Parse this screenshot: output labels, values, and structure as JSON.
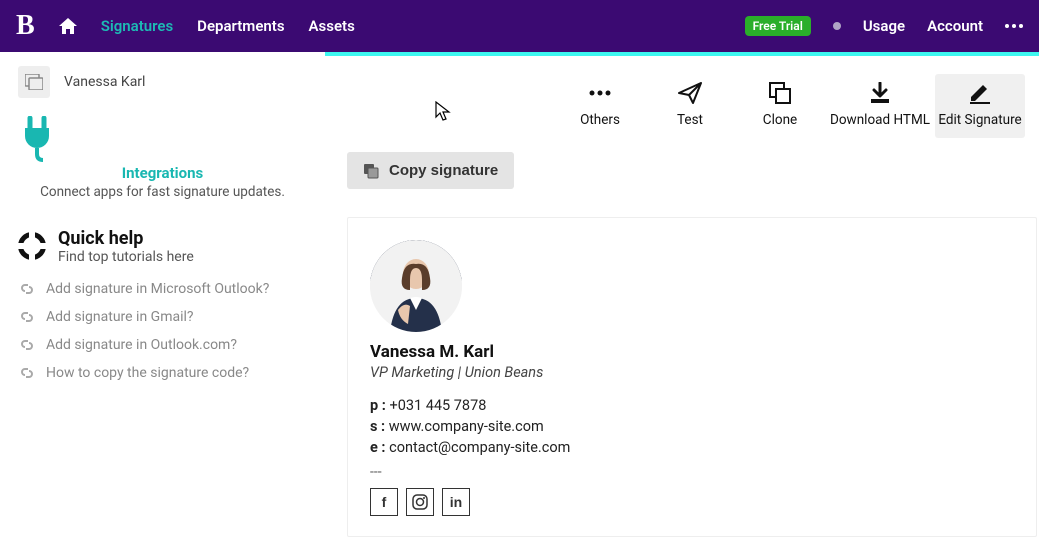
{
  "header": {
    "logo_text": "B",
    "nav": [
      "Signatures",
      "Departments",
      "Assets"
    ],
    "free_trial": "Free Trial",
    "usage": "Usage",
    "account": "Account"
  },
  "sidebar": {
    "user_name": "Vanessa Karl",
    "integrations_title": "Integrations",
    "integrations_sub": "Connect apps for fast signature updates.",
    "quick_title": "Quick help",
    "quick_sub": "Find top tutorials here",
    "help_links": [
      "Add signature in Microsoft Outlook?",
      "Add signature in Gmail?",
      "Add signature in Outlook.com?",
      "How to copy the signature code?"
    ]
  },
  "toolbar": {
    "others": "Others",
    "test": "Test",
    "clone": "Clone",
    "download": "Download HTML",
    "edit": "Edit Signature",
    "copy_label": "Copy signature"
  },
  "signature": {
    "name": "Vanessa M. Karl",
    "title": "VP Marketing | Union Beans",
    "phone_label": "p :",
    "phone": "+031 445 7878",
    "site_label": "s :",
    "site": "www.company-site.com",
    "email_label": "e :",
    "email": "contact@company-site.com",
    "sep": "---",
    "socials": {
      "facebook": "f",
      "instagram": "ig",
      "linkedin": "in"
    }
  }
}
